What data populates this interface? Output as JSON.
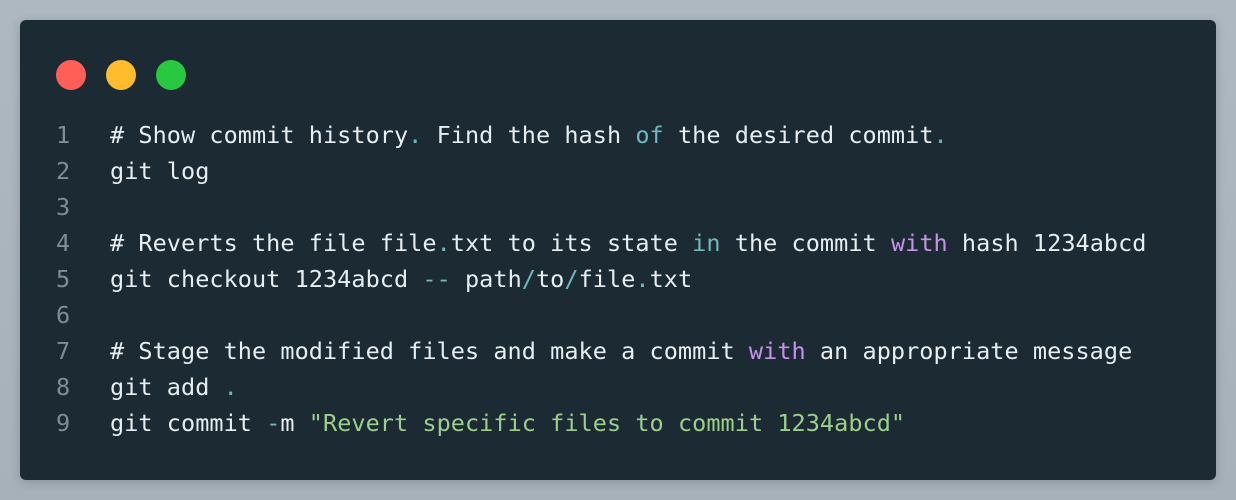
{
  "window_controls": {
    "close_color": "#ff5f57",
    "minimize_color": "#ffbd2e",
    "maximize_color": "#28c840"
  },
  "code": {
    "lines": [
      {
        "number": "1",
        "tokens": [
          {
            "text": "# Show commit history",
            "type": "text"
          },
          {
            "text": ".",
            "type": "punct"
          },
          {
            "text": " Find the hash ",
            "type": "text"
          },
          {
            "text": "of",
            "type": "punct"
          },
          {
            "text": " the desired commit",
            "type": "text"
          },
          {
            "text": ".",
            "type": "punct"
          }
        ]
      },
      {
        "number": "2",
        "tokens": [
          {
            "text": "git log",
            "type": "text"
          }
        ]
      },
      {
        "number": "3",
        "tokens": []
      },
      {
        "number": "4",
        "tokens": [
          {
            "text": "# Reverts the file file",
            "type": "text"
          },
          {
            "text": ".",
            "type": "punct"
          },
          {
            "text": "txt to its state ",
            "type": "text"
          },
          {
            "text": "in",
            "type": "punct"
          },
          {
            "text": " the commit ",
            "type": "text"
          },
          {
            "text": "with",
            "type": "kw"
          },
          {
            "text": " hash 1234abcd",
            "type": "text"
          }
        ]
      },
      {
        "number": "5",
        "tokens": [
          {
            "text": "git checkout 1234abcd ",
            "type": "text"
          },
          {
            "text": "--",
            "type": "op"
          },
          {
            "text": " path",
            "type": "text"
          },
          {
            "text": "/",
            "type": "op"
          },
          {
            "text": "to",
            "type": "text"
          },
          {
            "text": "/",
            "type": "op"
          },
          {
            "text": "file",
            "type": "text"
          },
          {
            "text": ".",
            "type": "punct"
          },
          {
            "text": "txt",
            "type": "text"
          }
        ]
      },
      {
        "number": "6",
        "tokens": []
      },
      {
        "number": "7",
        "tokens": [
          {
            "text": "# Stage the modified files and make a commit ",
            "type": "text"
          },
          {
            "text": "with",
            "type": "kw"
          },
          {
            "text": " an appropriate message",
            "type": "text"
          }
        ]
      },
      {
        "number": "8",
        "tokens": [
          {
            "text": "git add ",
            "type": "text"
          },
          {
            "text": ".",
            "type": "punct"
          }
        ]
      },
      {
        "number": "9",
        "tokens": [
          {
            "text": "git commit ",
            "type": "text"
          },
          {
            "text": "-",
            "type": "op"
          },
          {
            "text": "m ",
            "type": "text"
          },
          {
            "text": "\"Revert specific files to commit 1234abcd\"",
            "type": "str"
          }
        ]
      }
    ]
  }
}
